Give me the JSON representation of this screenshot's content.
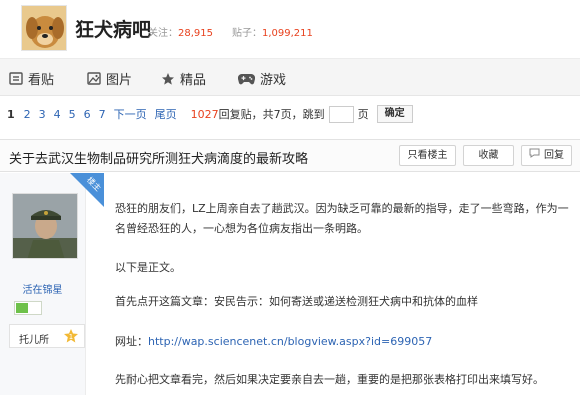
{
  "forum": {
    "name": "狂犬病吧",
    "follow_label": "关注：",
    "follow_count": "28,915",
    "posts_label": "贴子：",
    "posts_count": "1,099,211"
  },
  "nav": {
    "items": [
      {
        "label": "看贴",
        "icon": "posts-icon"
      },
      {
        "label": "图片",
        "icon": "picture-icon"
      },
      {
        "label": "精品",
        "icon": "star-icon"
      },
      {
        "label": "游戏",
        "icon": "gamepad-icon"
      }
    ]
  },
  "pager": {
    "current": "1",
    "pages": [
      "2",
      "3",
      "4",
      "5",
      "6",
      "7"
    ],
    "next": "下一页",
    "last": "尾页",
    "reply_count": "1027",
    "info": "回复贴，共7页，跳到",
    "page_unit": "页",
    "go": "确定"
  },
  "thread": {
    "title": "关于去武汉生物制品研究所测狂犬病滴度的最新攻略",
    "only_author": "只看楼主",
    "favorite": "收藏",
    "reply": "回复"
  },
  "author": {
    "tag": "楼主",
    "name": "活在锦星",
    "level_name": "托儿所",
    "level_num": "1"
  },
  "post": {
    "para1": "恐狂的朋友们，LZ上周亲自去了趟武汉。因为缺乏可靠的最新的指导，走了一些弯路，作为一名曾经恐狂的人，一心想为各位病友指出一条明路。",
    "para2": "以下是正文。",
    "para3": "首先点开这篇文章：安民告示：如何寄送或递送检测狂犬病中和抗体的血样",
    "para4_prefix": "网址：",
    "para4_link": "http://wap.sciencenet.cn/blogview.aspx?id=699057",
    "para5": "先耐心把文章看完，然后如果决定要亲自去一趟，重要的是把那张表格打印出来填写好。"
  },
  "colors": {
    "accent_red": "#e8421f",
    "link_blue": "#2d64b3",
    "tag_blue": "#4a90d9"
  }
}
